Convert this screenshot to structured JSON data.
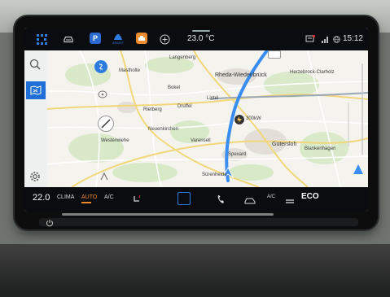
{
  "statusbar": {
    "parking_label": "P",
    "assist_label": "ASSIST",
    "temperature": "23.0 °C",
    "time": "15:12"
  },
  "map": {
    "places": [
      {
        "name": "Langenberg"
      },
      {
        "name": "Mastholte"
      },
      {
        "name": "Rheda-Wiedenbrück"
      },
      {
        "name": "Herzebrock-Clarholz"
      },
      {
        "name": "Bokel"
      },
      {
        "name": "Lintel"
      },
      {
        "name": "Rietberg"
      },
      {
        "name": "Druffel"
      },
      {
        "name": "Neuenkirchen"
      },
      {
        "name": "Gütersloh"
      },
      {
        "name": "Blankenhagen"
      },
      {
        "name": "Westerwiehe"
      },
      {
        "name": "Varensell"
      },
      {
        "name": "Spexard"
      },
      {
        "name": "Sürenheide"
      }
    ],
    "charger_label": "300kW"
  },
  "bottombar": {
    "temperature": "22.0",
    "clima": "CLIMA",
    "auto": "AUTO",
    "ac": "A/C",
    "ac_small": "A/C",
    "eco": "ECO"
  },
  "colors": {
    "accent": "#2d7de0",
    "route": "#3a8df0",
    "auto": "#f08a2e"
  }
}
